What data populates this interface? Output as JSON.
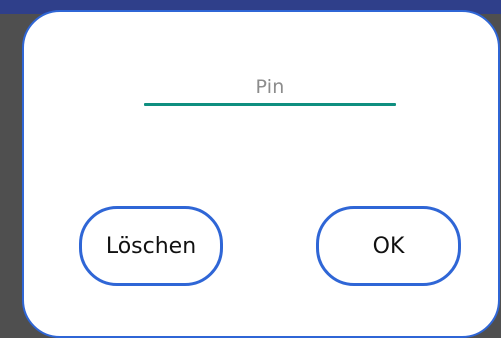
{
  "dialog": {
    "pin_field": {
      "placeholder": "Pin"
    },
    "buttons": {
      "delete": "Löschen",
      "ok": "OK"
    }
  },
  "colors": {
    "accent_outline": "#2f66d6",
    "input_underline": "#0f8f80",
    "placeholder_text": "#8c8c8c"
  }
}
